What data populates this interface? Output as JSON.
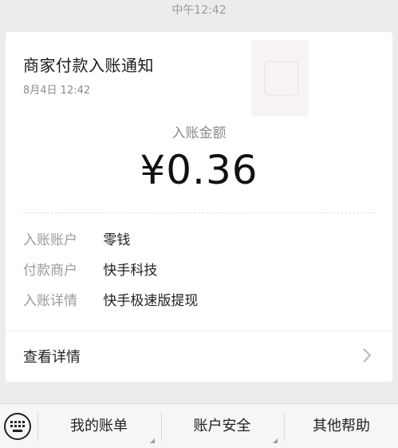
{
  "chat": {
    "timestamp": "中午12:42"
  },
  "card": {
    "title": "商家付款入账通知",
    "date": "8月4日  12:42",
    "amount_label": "入账金额",
    "amount": "¥0.36",
    "details": [
      {
        "label": "入账账户",
        "value": "零钱"
      },
      {
        "label": "付款商户",
        "value": "快手科技"
      },
      {
        "label": "入账详情",
        "value": "快手极速版提现"
      }
    ],
    "view_details": "查看详情"
  },
  "bottom_menu": {
    "items": [
      {
        "label": "我的账单"
      },
      {
        "label": "账户安全"
      },
      {
        "label": "其他帮助"
      }
    ]
  },
  "icons": {
    "keyboard": "keyboard-icon",
    "chevron": "chevron-right-icon",
    "merchant_logo": "merchant-logo-icon"
  }
}
